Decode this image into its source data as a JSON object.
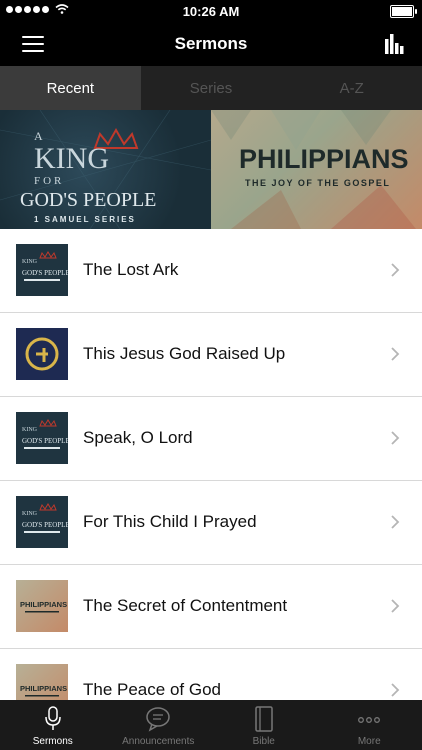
{
  "status": {
    "time": "10:26 AM"
  },
  "navbar": {
    "title": "Sermons"
  },
  "tabs": [
    {
      "label": "Recent",
      "active": true
    },
    {
      "label": "Series",
      "active": false
    },
    {
      "label": "A-Z",
      "active": false
    }
  ],
  "banners": [
    {
      "name": "king-series",
      "lines": [
        "A",
        "KING",
        "FOR",
        "GOD'S PEOPLE",
        "1 SAMUEL SERIES"
      ]
    },
    {
      "name": "philippians-series",
      "lines": [
        "PHILIPPIANS",
        "THE JOY OF THE GOSPEL"
      ]
    }
  ],
  "sermons": [
    {
      "title": "The Lost Ark",
      "thumb": "king"
    },
    {
      "title": "This Jesus God Raised Up",
      "thumb": "g-logo"
    },
    {
      "title": "Speak, O Lord",
      "thumb": "king"
    },
    {
      "title": "For This Child I Prayed",
      "thumb": "king"
    },
    {
      "title": "The Secret of Contentment",
      "thumb": "phil"
    },
    {
      "title": "The Peace of God",
      "thumb": "phil"
    }
  ],
  "tabbar": [
    {
      "label": "Sermons",
      "icon": "microphone-icon",
      "active": true
    },
    {
      "label": "Announcements",
      "icon": "speech-bubble-icon",
      "active": false
    },
    {
      "label": "Bible",
      "icon": "book-icon",
      "active": false
    },
    {
      "label": "More",
      "icon": "ellipsis-icon",
      "active": false
    }
  ],
  "colors": {
    "bar": "#000000",
    "tabbar": "#1a1a1a",
    "accent_gold": "#d9b54a",
    "king_red": "#c0392b"
  }
}
